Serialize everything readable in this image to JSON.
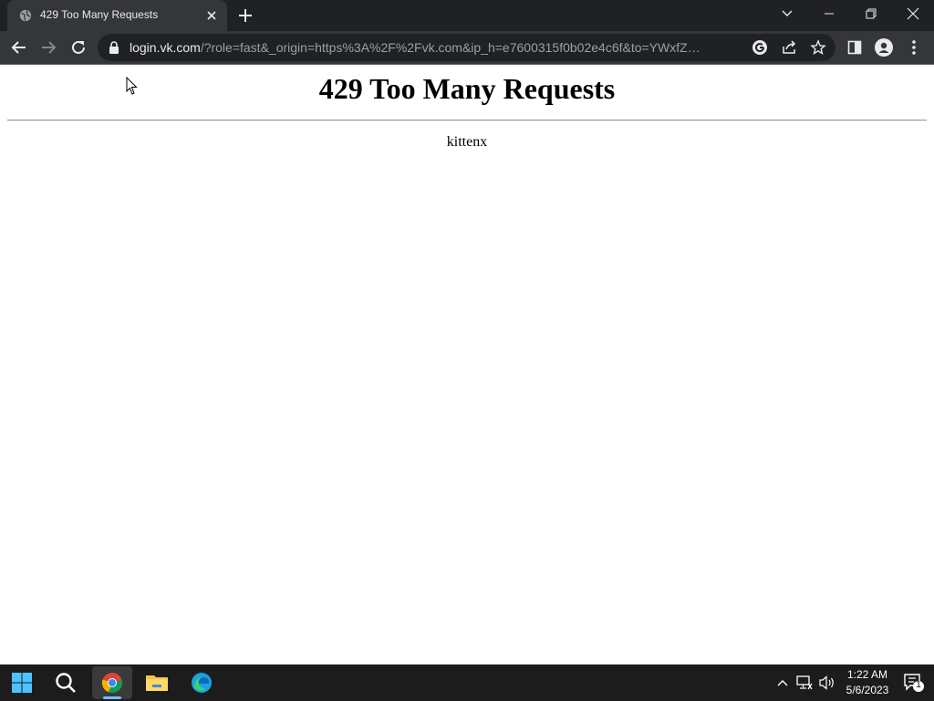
{
  "browser": {
    "tab": {
      "title": "429 Too Many Requests"
    },
    "address": {
      "host": "login.vk.com",
      "path": "/?role=fast&_origin=https%3A%2F%2Fvk.com&ip_h=e7600315f0b02e4c6f&to=YWxfZmVlZC5..."
    }
  },
  "page": {
    "heading": "429 Too Many Requests",
    "server_name": "kittenx"
  },
  "taskbar": {
    "time": "1:22 AM",
    "date": "5/6/2023",
    "notification_count": "1"
  },
  "colors": {
    "tabstrip_bg": "#202124",
    "toolbar_bg": "#35363a",
    "taskbar_bg": "#1c1c1c",
    "accent": "#6ec0ff"
  }
}
